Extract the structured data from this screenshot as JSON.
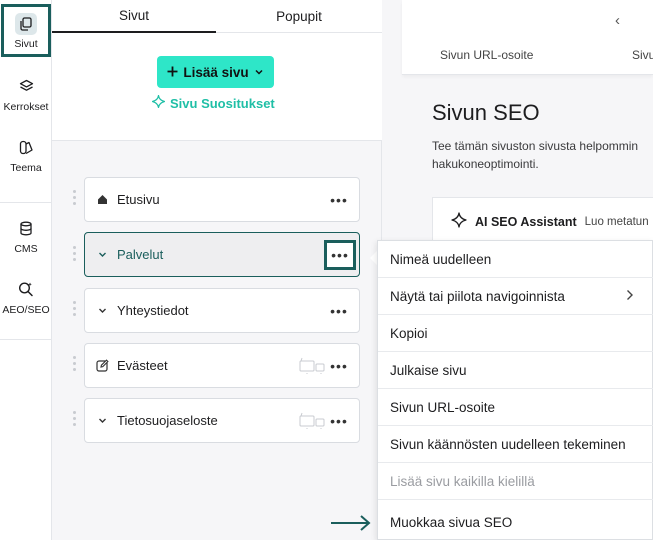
{
  "rail": {
    "items": [
      {
        "label": "Sivut",
        "icon": "pages-icon",
        "active": true
      },
      {
        "label": "Kerrokset",
        "icon": "layers-icon"
      },
      {
        "label": "Teema",
        "icon": "theme-icon"
      },
      {
        "label": "CMS",
        "icon": "database-icon"
      },
      {
        "label": "AEO/SEO",
        "icon": "seo-search-icon"
      }
    ]
  },
  "panel": {
    "tabs": [
      "Sivut",
      "Popupit"
    ],
    "add_button": "Lisää sivu",
    "recommendations": "Sivu Suositukset",
    "pages": [
      {
        "label": "Etusivu",
        "icon": "home-icon"
      },
      {
        "label": "Palvelut",
        "icon": "chevron-down-icon",
        "selected": true
      },
      {
        "label": "Yhteystiedot",
        "icon": "chevron-down-icon"
      },
      {
        "label": "Evästeet",
        "icon": "edit-icon",
        "unpublished": true
      },
      {
        "label": "Tietosuojaseloste",
        "icon": "chevron-down-icon",
        "unpublished": true
      }
    ]
  },
  "seo": {
    "back": "‹",
    "tabs": [
      "Sivun URL-osoite",
      "Sivu"
    ],
    "title": "Sivun SEO",
    "description_lines": [
      "Tee tämän sivuston sivusta helpommin",
      "hakukoneoptimointi."
    ],
    "ai_title": "AI SEO Assistant",
    "ai_subtitle": "Luo metatun"
  },
  "menu": {
    "items": [
      {
        "label": "Nimeä uudelleen"
      },
      {
        "label": "Näytä tai piilota navigoinnista",
        "submenu": true
      },
      {
        "label": "Kopioi"
      },
      {
        "label": "Julkaise sivu"
      },
      {
        "label": "Sivun URL-osoite"
      },
      {
        "label": "Sivun käännösten uudelleen tekeminen"
      },
      {
        "label": "Lisää sivu kaikilla kielillä",
        "disabled": true
      },
      {
        "label": "Muokkaa sivua SEO"
      }
    ]
  },
  "colors": {
    "accent": "#2ee6c8",
    "highlight": "#1a5e5c",
    "link": "#1fbfa6"
  }
}
